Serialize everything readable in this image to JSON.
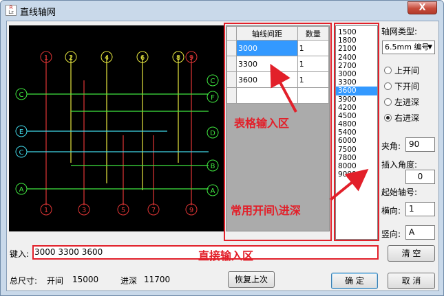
{
  "window": {
    "title": "直线轴网",
    "close_label": "X",
    "icon_top": "R",
    "icon_bottom": "Lz"
  },
  "table": {
    "headers": [
      "轴线间距",
      "数量"
    ],
    "rows": [
      {
        "spacing": "3000",
        "count": "1"
      },
      {
        "spacing": "3300",
        "count": "1"
      },
      {
        "spacing": "3600",
        "count": "1"
      }
    ]
  },
  "list": {
    "items": [
      "1500",
      "1800",
      "2100",
      "2400",
      "2700",
      "3000",
      "3300",
      "3600",
      "3900",
      "4200",
      "4500",
      "4800",
      "5400",
      "6000",
      "7500",
      "7800",
      "8000",
      "9000"
    ],
    "selected_index": 7
  },
  "right_panel": {
    "type_label": "轴网类型:",
    "type_value": "6.5mm 编号",
    "radios": [
      {
        "label": "上开间",
        "checked": false
      },
      {
        "label": "下开间",
        "checked": false
      },
      {
        "label": "左进深",
        "checked": false
      },
      {
        "label": "右进深",
        "checked": true
      }
    ],
    "angle_label": "夹角:",
    "angle_value": "90",
    "insert_angle_label": "插入角度:",
    "insert_angle_value": "0",
    "start_label": "起始轴号:",
    "horizontal_label": "横向:",
    "horizontal_value": "1",
    "vertical_label": "竖向:",
    "vertical_value": "A"
  },
  "input": {
    "label": "键入:",
    "value": "3000  3300  3600"
  },
  "buttons": {
    "clear": "清 空",
    "restore": "恢复上次",
    "ok": "确 定",
    "cancel": "取 消"
  },
  "status": {
    "total_label": "总尺寸:",
    "bay_label": "开间",
    "bay_value": "15000",
    "depth_label": "进深",
    "depth_value": "11700"
  },
  "annotations": {
    "table_area": "表格输入区",
    "common_area": "常用开间\\进深",
    "direct_area": "直接输入区"
  },
  "cad": {
    "top_labels": [
      "1",
      "2",
      "4",
      "6",
      "8",
      "9"
    ],
    "bottom_labels": [
      "1",
      "3",
      "5",
      "7",
      "9"
    ],
    "left_labels": [
      "C",
      "E",
      "C",
      "A"
    ],
    "right_labels": [
      "C",
      "F",
      "D",
      "B",
      "A"
    ]
  },
  "colors": {
    "accent": "#3399ff",
    "annotation": "#e2202a",
    "cad_bg": "#000000"
  }
}
